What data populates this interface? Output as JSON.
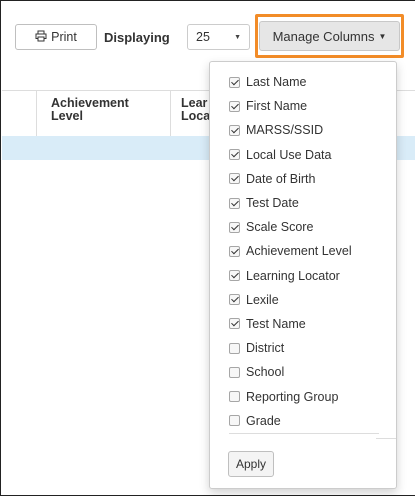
{
  "toolbar": {
    "print_label": "Print",
    "displaying_label": "Displaying",
    "page_size": "25",
    "manage_columns_label": "Manage Columns"
  },
  "grid": {
    "columns": [
      {
        "label": "Achievement\nLevel"
      },
      {
        "label": "Lear\nLoca"
      }
    ]
  },
  "columns_menu": {
    "items": [
      {
        "label": "Last Name",
        "checked": true
      },
      {
        "label": "First Name",
        "checked": true
      },
      {
        "label": "MARSS/SSID",
        "checked": true
      },
      {
        "label": "Local Use Data",
        "checked": true
      },
      {
        "label": "Date of Birth",
        "checked": true
      },
      {
        "label": "Test Date",
        "checked": true
      },
      {
        "label": "Scale Score",
        "checked": true
      },
      {
        "label": "Achievement Level",
        "checked": true
      },
      {
        "label": "Learning Locator",
        "checked": true
      },
      {
        "label": "Lexile",
        "checked": true
      },
      {
        "label": "Test Name",
        "checked": true
      },
      {
        "label": "District",
        "checked": false
      },
      {
        "label": "School",
        "checked": false
      },
      {
        "label": "Reporting Group",
        "checked": false
      },
      {
        "label": "Grade",
        "checked": false
      }
    ],
    "apply_label": "Apply"
  },
  "colors": {
    "highlight": "#f28c28",
    "selected_row": "#d9ecf8",
    "manage_button_bg": "#e6e6e6"
  }
}
